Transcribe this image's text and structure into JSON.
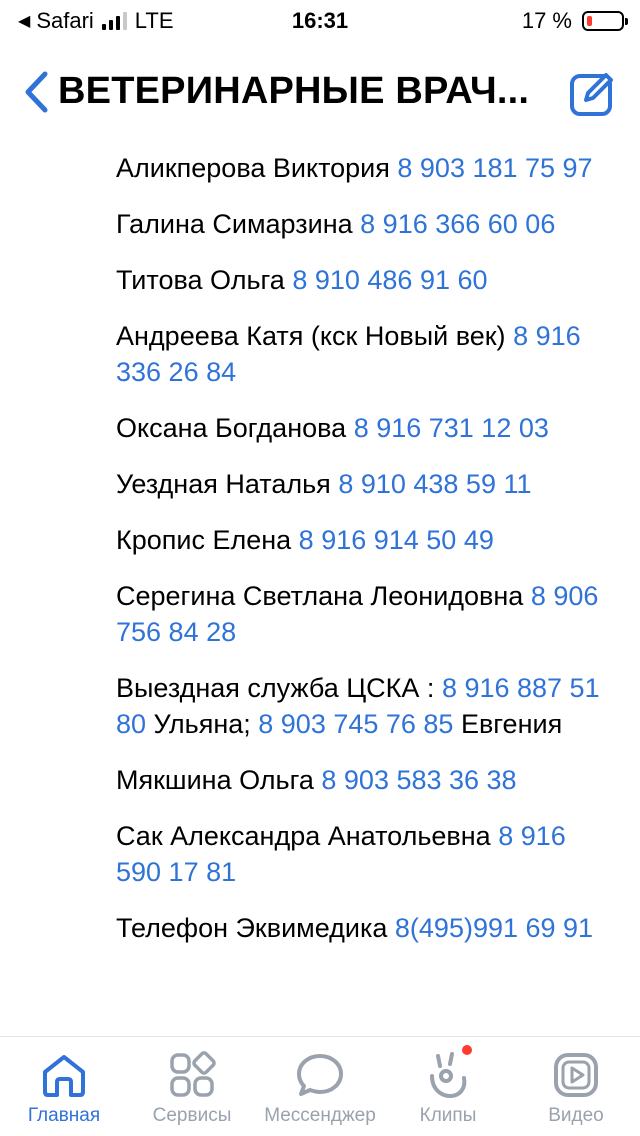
{
  "status_bar": {
    "carrier": "Safari",
    "network": "LTE",
    "time": "16:31",
    "battery_percent": "17 %",
    "battery_level": 0.17,
    "battery_color": "#ff3b30"
  },
  "header": {
    "title": "ВЕТЕРИНАРНЫЕ ВРАЧ..."
  },
  "colors": {
    "accent": "#2f73d8",
    "inactive": "#99a2ad"
  },
  "contacts": [
    {
      "text": "Аликперова Виктория ",
      "phone": "8 903 181 75 97",
      "suffix": ""
    },
    {
      "text": "Галина Симарзина ",
      "phone": "8 916 366 60 06",
      "suffix": ""
    },
    {
      "text": "Титова Ольга ",
      "phone": "8 910 486 91 60",
      "suffix": ""
    },
    {
      "text": "Андреева Катя (кск Новый век) ",
      "phone": "8 916 336 26 84",
      "suffix": ""
    },
    {
      "text": "Оксана Богданова ",
      "phone": "8 916 731 12 03",
      "suffix": ""
    },
    {
      "text": "Уездная Наталья ",
      "phone": "8 910 438 59 11",
      "suffix": ""
    },
    {
      "text": "Кропис Елена ",
      "phone": "8 916 914 50 49",
      "suffix": ""
    },
    {
      "text": "Серегина Светлана Леонидовна ",
      "phone": "8 906 756 84 28",
      "suffix": ""
    },
    {
      "text": "Выездная служба ЦСКА : ",
      "phone": "8 916 887 51 80",
      "suffix": " Ульяна; ",
      "phone2": "8 903 745 76 85",
      "suffix2": " Евгения"
    },
    {
      "text": "Мякшина Ольга ",
      "phone": "8 903 583 36 38",
      "suffix": ""
    },
    {
      "text": "Сак Александра Анатольевна ",
      "phone": "8 916 590 17 81",
      "suffix": ""
    },
    {
      "text": "Телефон Эквимедика ",
      "phone": "8(495)991 69 91",
      "suffix": ""
    }
  ],
  "tabs": [
    {
      "label": "Главная",
      "icon": "home-icon",
      "active": true
    },
    {
      "label": "Сервисы",
      "icon": "services-icon",
      "active": false
    },
    {
      "label": "Мессенджер",
      "icon": "messenger-icon",
      "active": false
    },
    {
      "label": "Клипы",
      "icon": "clips-icon",
      "active": false,
      "badge": true
    },
    {
      "label": "Видео",
      "icon": "video-icon",
      "active": false
    }
  ]
}
